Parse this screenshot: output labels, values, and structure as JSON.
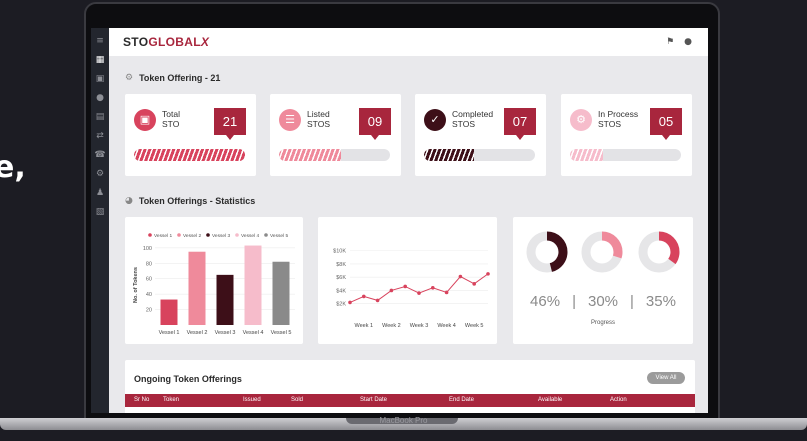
{
  "background_text": "e,",
  "laptop_label": "MacBook Pro",
  "brand": {
    "part1": "STO",
    "part2": "GLOBAL",
    "mark": "X"
  },
  "sidebar": {
    "icons": [
      "menu-icon",
      "dashboard-icon",
      "calendar-icon",
      "user-icon",
      "table-icon",
      "transfer-icon",
      "phone-icon",
      "settings-icon",
      "profile-icon",
      "document-icon"
    ]
  },
  "top_icons": [
    "bell-icon",
    "user-icon"
  ],
  "sections": {
    "offering": "Token Offering - 21",
    "statistics": "Token Offerings - Statistics"
  },
  "stats": [
    {
      "label_line1": "Total",
      "label_line2": "STO",
      "value": "21",
      "icon": "tokens-icon",
      "color": "#d8435d",
      "fraction": 1.0
    },
    {
      "label_line1": "Listed",
      "label_line2": "STOS",
      "value": "09",
      "icon": "list-icon",
      "color": "#ef8a9b",
      "fraction": 0.56
    },
    {
      "label_line1": "Completed",
      "label_line2": "STOS",
      "value": "07",
      "icon": "completed-icon",
      "color": "#3d0f18",
      "fraction": 0.45
    },
    {
      "label_line1": "In Process",
      "label_line2": "STOS",
      "value": "05",
      "icon": "gear-icon",
      "color": "#f6bccb",
      "fraction": 0.3
    }
  ],
  "chart_data": [
    {
      "type": "bar",
      "categories": [
        "Vessel 1",
        "Vessel 2",
        "Vessel 3",
        "Vessel 4",
        "Vessel 5"
      ],
      "values": [
        33,
        95,
        65,
        103,
        82
      ],
      "colors": [
        "#d8435d",
        "#ef8a9b",
        "#3d0f18",
        "#f6bccb",
        "#8a8a8a"
      ],
      "legend": [
        "Vessel 1",
        "Vessel 2",
        "Vessel 3",
        "Vessel 4",
        "Vessel 5"
      ],
      "ylabel": "No. of Tokens",
      "yticks": [
        "20",
        "40",
        "60",
        "80",
        "100"
      ],
      "ylim": [
        0,
        105
      ]
    },
    {
      "type": "line",
      "x": [
        "Week 1",
        "Week 2",
        "Week 3",
        "Week 4",
        "Week 5"
      ],
      "points": [
        2.2,
        3.1,
        2.5,
        4.0,
        4.6,
        3.6,
        4.4,
        3.7,
        6.1,
        5.0,
        6.5
      ],
      "yticks": [
        "$2K",
        "$4K",
        "$6K",
        "$8K",
        "$10K"
      ],
      "ylim": [
        0,
        11
      ],
      "color": "#d8435d"
    },
    {
      "type": "pie",
      "rings": [
        {
          "value": 46,
          "label": "46%",
          "color": "#3d0f18"
        },
        {
          "value": 30,
          "label": "30%",
          "color": "#ef8a9b"
        },
        {
          "value": 35,
          "label": "35%",
          "color": "#d8435d"
        }
      ],
      "label": "Progress"
    }
  ],
  "ongoing": {
    "title": "Ongoing Token Offerings",
    "view_all": "View All",
    "columns": [
      "Sr No",
      "Token",
      "Issued",
      "Sold",
      "Start Date",
      "End Date",
      "Available",
      "Action"
    ]
  }
}
